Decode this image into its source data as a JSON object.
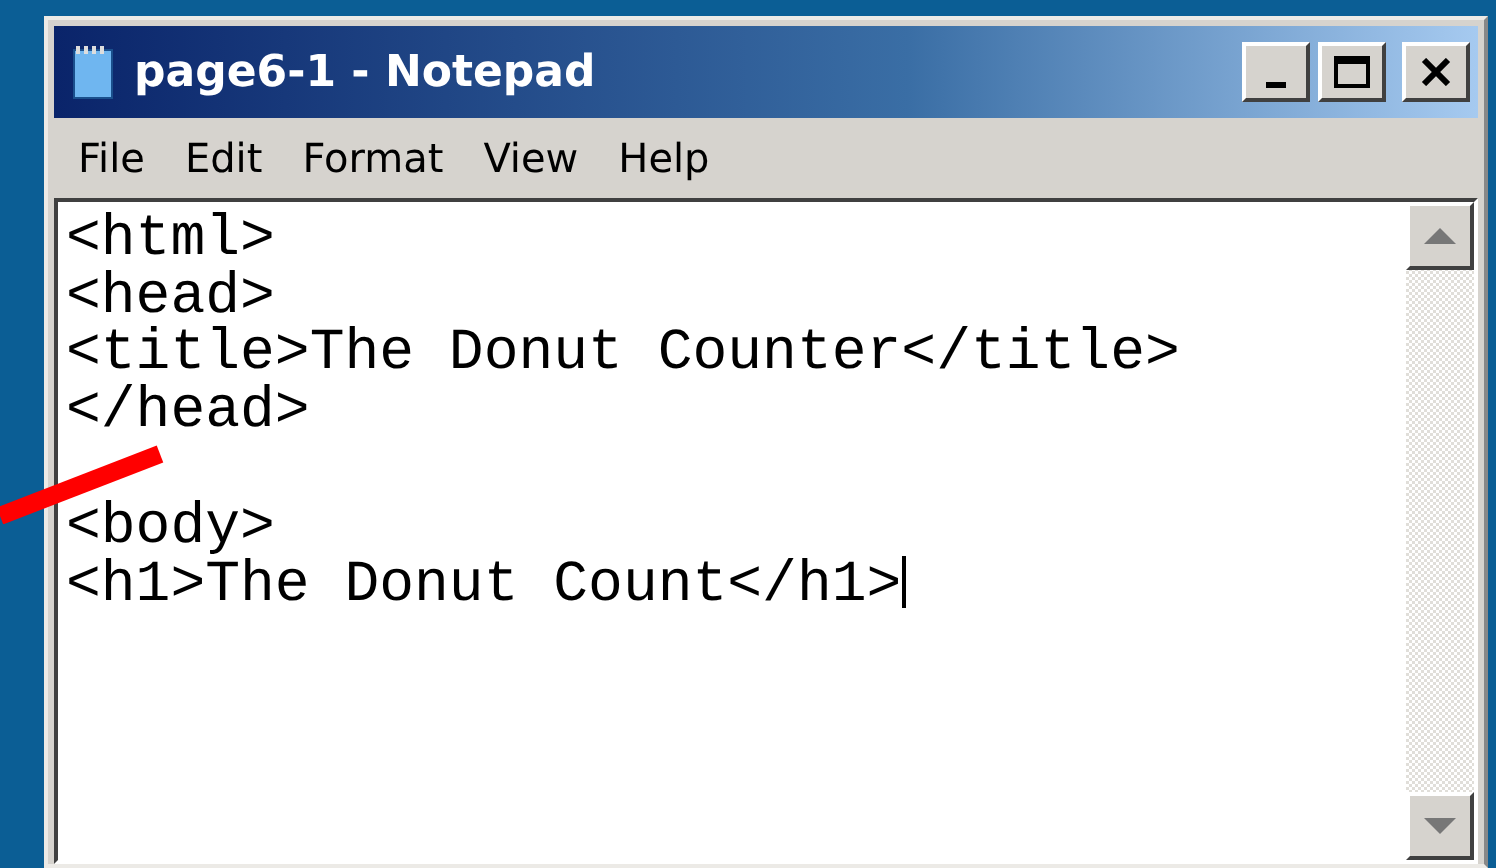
{
  "window": {
    "title": "page6-1 - Notepad"
  },
  "menu": [
    "File",
    "Edit",
    "Format",
    "View",
    "Help"
  ],
  "editor": {
    "blocks": [
      "<html>\n<head>\n<title>The Donut Counter</title>\n</head>",
      "<body>\n<h1>The Donut Count</h1>"
    ],
    "cursor_visible": true
  }
}
